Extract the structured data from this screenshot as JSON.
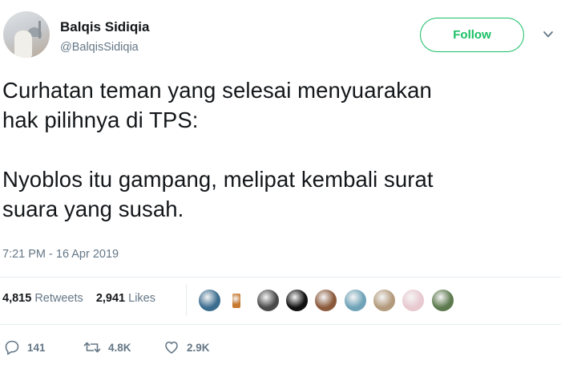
{
  "user": {
    "display_name": "Balqis Sidiqia",
    "handle": "@BalqisSidiqia"
  },
  "header": {
    "follow_label": "Follow"
  },
  "tweet": {
    "line_1": "Curhatan teman yang selesai menyuarakan",
    "line_2": "hak pilihnya di TPS:",
    "line_3": "Nyoblos itu gampang, melipat kembali surat",
    "line_4": "suara yang susah.",
    "timestamp": "7:21 PM - 16 Apr 2019"
  },
  "stats": {
    "retweets_count": "4,815",
    "retweets_label": "Retweets",
    "likes_count": "2,941",
    "likes_label": "Likes"
  },
  "likers": [
    {
      "name": "liker-avatar-1",
      "color": "#3b6d8f"
    },
    {
      "name": "liker-avatar-2",
      "color": "#c7792f"
    },
    {
      "name": "liker-avatar-3",
      "color": "#4a4a4a"
    },
    {
      "name": "liker-avatar-4",
      "color": "#111111"
    },
    {
      "name": "liker-avatar-5",
      "color": "#8b5a3c"
    },
    {
      "name": "liker-avatar-6",
      "color": "#6fa3b8"
    },
    {
      "name": "liker-avatar-7",
      "color": "#b39a7c"
    },
    {
      "name": "liker-avatar-8",
      "color": "#e8c9d0"
    },
    {
      "name": "liker-avatar-9",
      "color": "#5d7a4e"
    }
  ],
  "actions": {
    "replies": "141",
    "retweets": "4.8K",
    "likes": "2.9K"
  },
  "colors": {
    "follow_green": "#17bf63",
    "secondary_text": "#657786",
    "divider": "#e6ecf0"
  },
  "icons": [
    "chevron-down-icon",
    "reply-icon",
    "retweet-icon",
    "heart-icon"
  ]
}
